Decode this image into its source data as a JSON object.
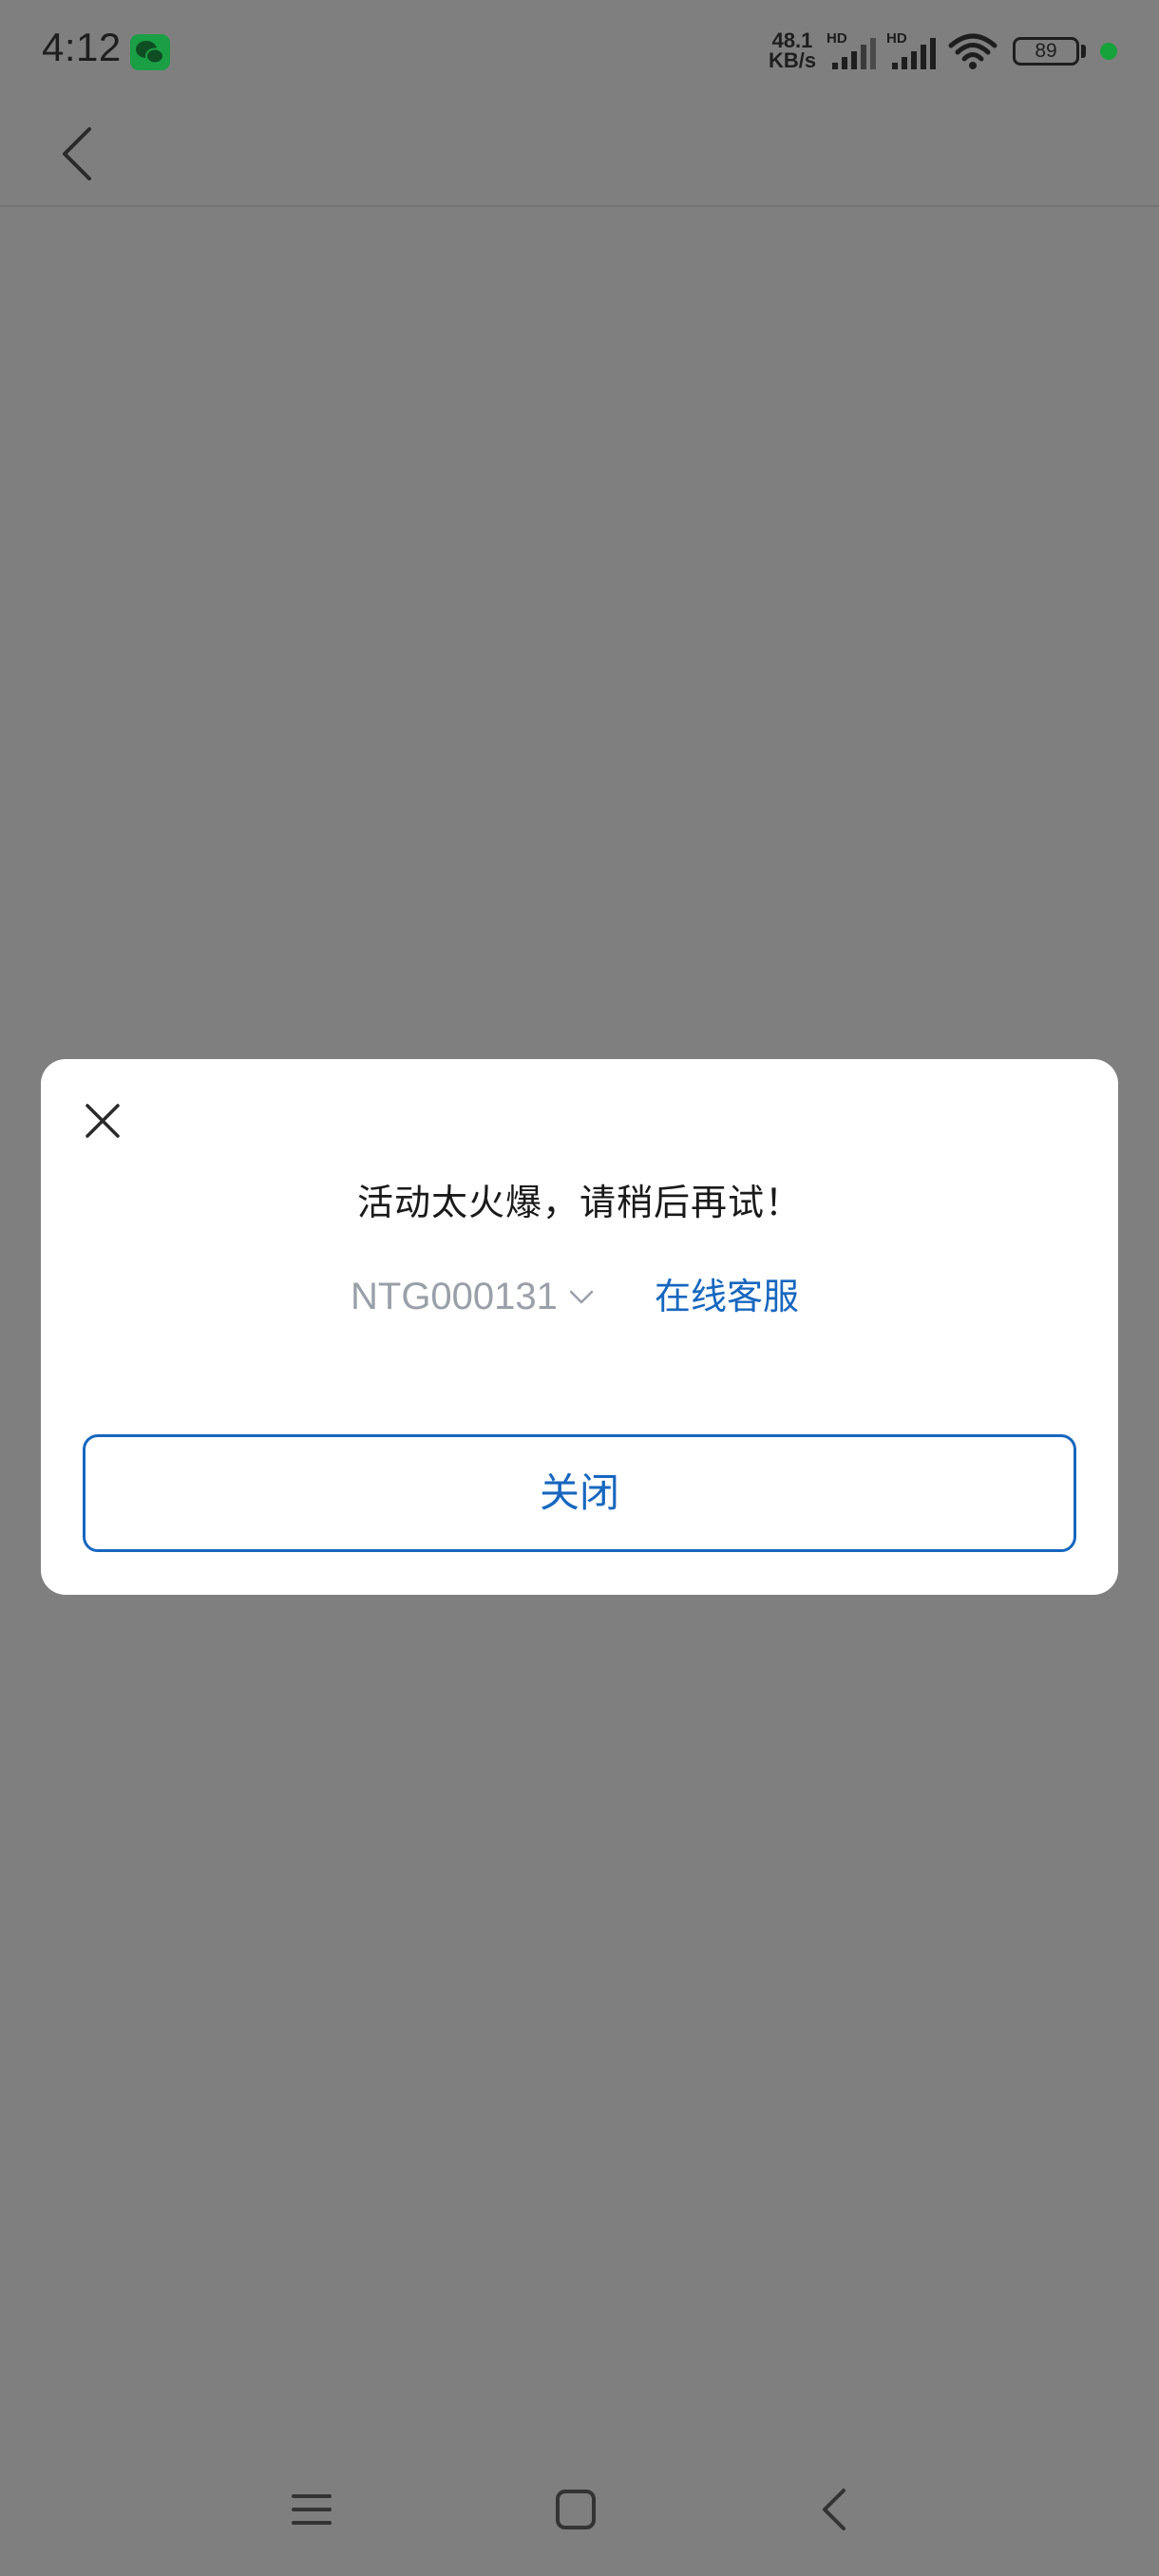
{
  "status_bar": {
    "time": "4:12",
    "net_speed_value": "48.1",
    "net_speed_unit": "KB/s",
    "hd1": "HD",
    "hd2": "HD",
    "battery_level": "89"
  },
  "dialog": {
    "message": "活动太火爆，请稍后再试！",
    "code": "NTG000131",
    "service_link": "在线客服",
    "close_label": "关闭"
  },
  "colors": {
    "accent": "#1767bf",
    "overlay_bg": "#7f7f7f",
    "dialog_bg": "#ffffff"
  }
}
